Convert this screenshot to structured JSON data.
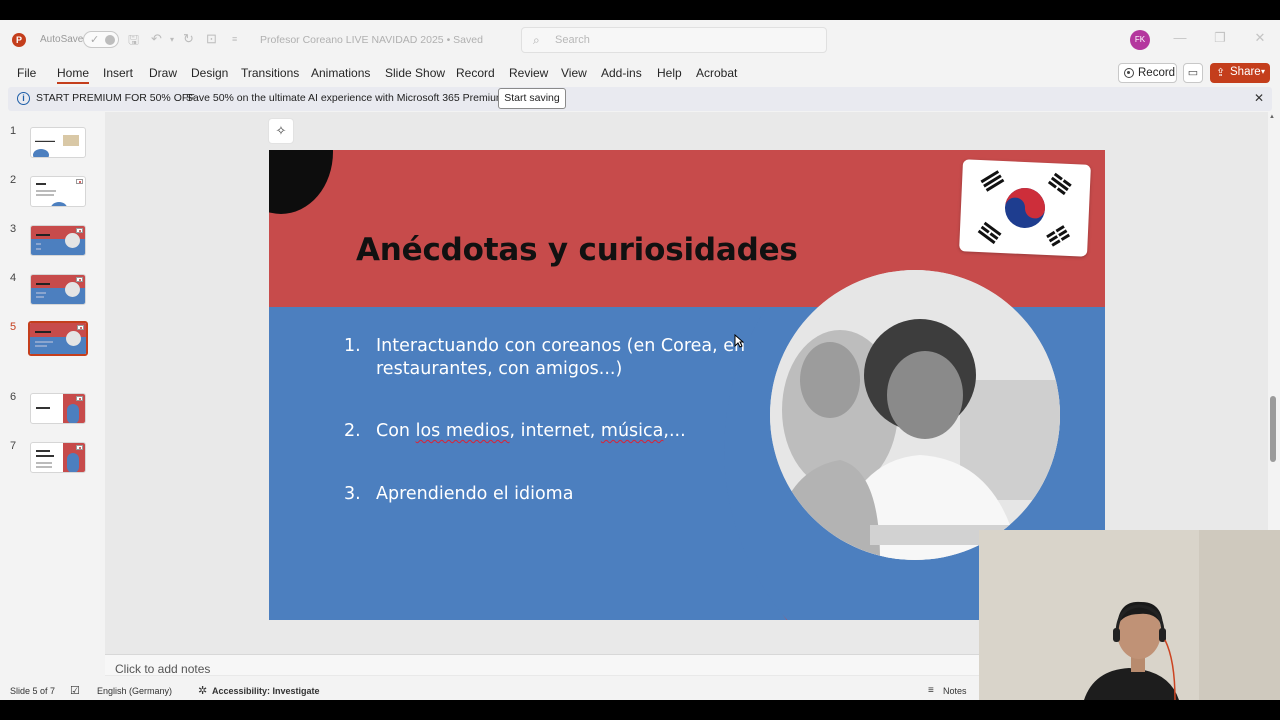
{
  "titlebar": {
    "autosave_label": "AutoSave",
    "doc_title": "Profesor Coreano LIVE NAVIDAD 2025 • Saved",
    "search_placeholder": "Search",
    "avatar_initials": "FK"
  },
  "menu": {
    "items": [
      "File",
      "Home",
      "Insert",
      "Draw",
      "Design",
      "Transitions",
      "Animations",
      "Slide Show",
      "Record",
      "Review",
      "View",
      "Add-ins",
      "Help",
      "Acrobat"
    ],
    "active": "Home",
    "record_label": "Record",
    "share_label": "Share"
  },
  "premium": {
    "bold": "START PREMIUM FOR 50% OFF",
    "message": "Save 50% on the ultimate AI experience with Microsoft 365 Premium.",
    "button": "Start saving"
  },
  "thumbnails": {
    "numbers": [
      "1",
      "2",
      "3",
      "4",
      "5",
      "6",
      "7"
    ],
    "active_index": 5
  },
  "slide": {
    "title": "Anécdotas y curiosidades",
    "items": [
      {
        "num": "1.",
        "text": "Interactuando con coreanos (en Corea, en restaurantes, con amigos...)"
      },
      {
        "num": "2.",
        "text_a": "Con ",
        "text_b": "los medios",
        "text_c": ", internet, ",
        "text_d": "música",
        "text_e": ",..."
      },
      {
        "num": "3.",
        "text": "Aprendiendo el idioma"
      }
    ]
  },
  "notes_placeholder": "Click to add notes",
  "status": {
    "slide": "Slide 5 of 7",
    "language": "English (Germany)",
    "accessibility": "Accessibility: Investigate",
    "notes": "Notes"
  },
  "colors": {
    "accent": "#c43e1c",
    "slide_red": "#c74b4b",
    "slide_blue": "#4c7fbf"
  }
}
